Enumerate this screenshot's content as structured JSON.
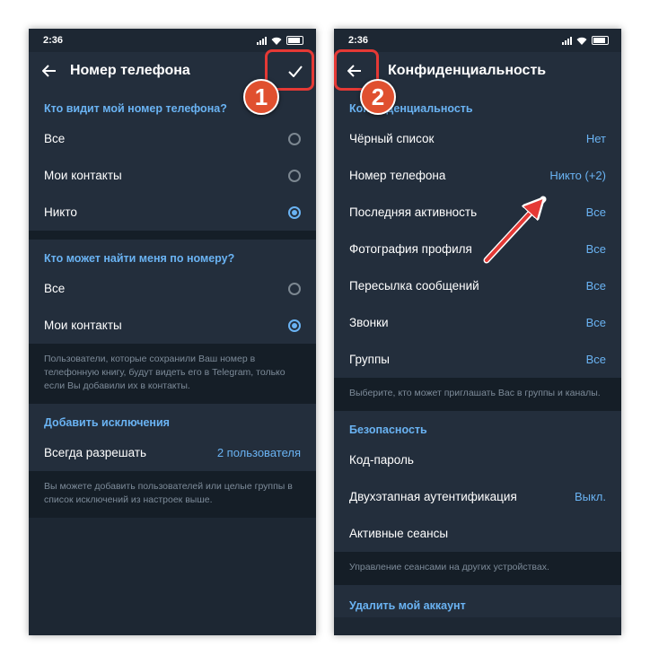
{
  "left": {
    "status": {
      "time": "2:36"
    },
    "title": "Номер телефона",
    "section1": {
      "header": "Кто видит мой номер телефона?",
      "options": [
        {
          "label": "Все",
          "selected": false
        },
        {
          "label": "Мои контакты",
          "selected": false
        },
        {
          "label": "Никто",
          "selected": true
        }
      ]
    },
    "section2": {
      "header": "Кто может найти меня по номеру?",
      "options": [
        {
          "label": "Все",
          "selected": false
        },
        {
          "label": "Мои контакты",
          "selected": true
        }
      ],
      "note": "Пользователи, которые сохранили Ваш номер в телефонную книгу, будут видеть его в Telegram, только если Вы добавили их в контакты."
    },
    "section3": {
      "header": "Добавить исключения",
      "row_label": "Всегда разрешать",
      "row_value": "2 пользователя",
      "note": "Вы можете добавить пользователей или целые группы в список исключений из настроек выше."
    }
  },
  "right": {
    "status": {
      "time": "2:36"
    },
    "title": "Конфиденциальность",
    "privacy": {
      "header": "Конфиденциальность",
      "rows": [
        {
          "label": "Чёрный список",
          "value": "Нет"
        },
        {
          "label": "Номер телефона",
          "value": "Никто (+2)"
        },
        {
          "label": "Последняя активность",
          "value": "Все"
        },
        {
          "label": "Фотография профиля",
          "value": "Все"
        },
        {
          "label": "Пересылка сообщений",
          "value": "Все"
        },
        {
          "label": "Звонки",
          "value": "Все"
        },
        {
          "label": "Группы",
          "value": "Все"
        }
      ],
      "note": "Выберите, кто может приглашать Вас в группы и каналы."
    },
    "security": {
      "header": "Безопасность",
      "rows": [
        {
          "label": "Код-пароль",
          "value": ""
        },
        {
          "label": "Двухэтапная аутентификация",
          "value": "Выкл."
        },
        {
          "label": "Активные сеансы",
          "value": ""
        }
      ],
      "note": "Управление сеансами на других устройствах."
    },
    "delete": {
      "header": "Удалить мой аккаунт"
    }
  },
  "annotations": {
    "badge1": "1",
    "badge2": "2",
    "color": "#e53935"
  },
  "colors": {
    "accent": "#6ab3f3",
    "background": "#1d2733",
    "surface": "#232e3c",
    "divider": "#151e27"
  }
}
